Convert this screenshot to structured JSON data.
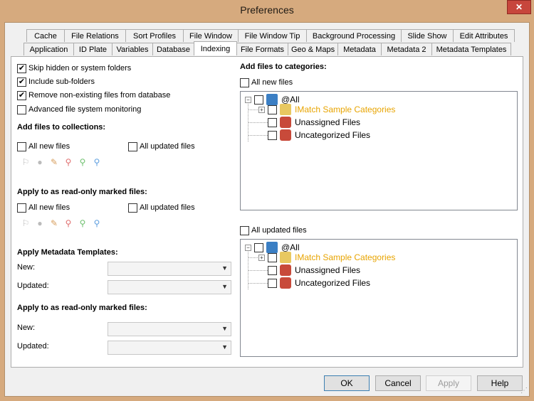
{
  "window": {
    "title": "Preferences"
  },
  "tabs": {
    "row1": [
      "Cache",
      "File Relations",
      "Sort Profiles",
      "File Window",
      "File Window Tip",
      "Background Processing",
      "Slide Show",
      "Edit Attributes"
    ],
    "row2": [
      "Application",
      "ID Plate",
      "Variables",
      "Database",
      "Indexing",
      "File Formats",
      "Geo & Maps",
      "Metadata",
      "Metadata 2",
      "Metadata Templates"
    ],
    "active": "Indexing"
  },
  "left": {
    "options": [
      {
        "label": "Skip hidden or system folders",
        "checked": true
      },
      {
        "label": "Include sub-folders",
        "checked": true
      },
      {
        "label": "Remove non-existing files from database",
        "checked": true
      },
      {
        "label": "Advanced file system monitoring",
        "checked": false
      }
    ],
    "collections_heading": "Add files to collections:",
    "collections_new": "All new files",
    "collections_updated": "All updated files",
    "readonly_heading": "Apply to as read-only marked files:",
    "readonly_new": "All new files",
    "readonly_updated": "All updated files",
    "templates_heading": "Apply Metadata Templates:",
    "templates_new_label": "New:",
    "templates_updated_label": "Updated:",
    "templates_readonly_heading": "Apply to as read-only marked files:",
    "templates_readonly_new_label": "New:",
    "templates_readonly_updated_label": "Updated:"
  },
  "right": {
    "heading": "Add files to categories:",
    "new_files_label": "All new files",
    "updated_files_label": "All updated files",
    "tree": {
      "root": "@All",
      "children": [
        "IMatch Sample Categories",
        "Unassigned Files",
        "Uncategorized Files"
      ],
      "highlight_color": "#e8a400"
    }
  },
  "buttons": {
    "ok": "OK",
    "cancel": "Cancel",
    "apply": "Apply",
    "help": "Help"
  }
}
